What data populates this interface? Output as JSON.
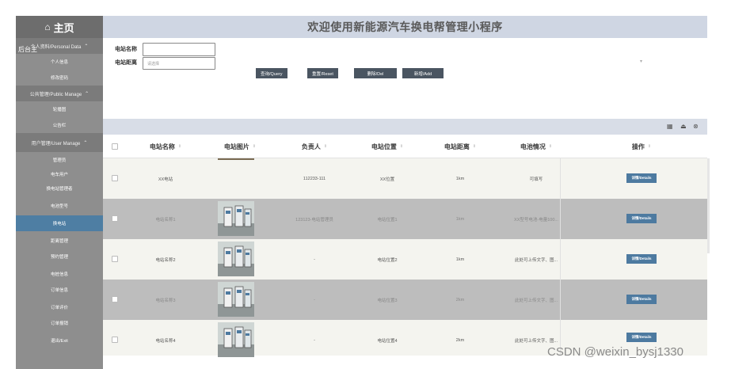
{
  "sidebar": {
    "home": "主页",
    "groups": [
      {
        "label": "个人资料/Personal Data",
        "overlay": "后台主",
        "items": [
          "个人信息",
          "修改密码"
        ]
      },
      {
        "label": "公共管理/Public Manage",
        "items": [
          "轮播图",
          "公告栏"
        ]
      },
      {
        "label": "用户管理/User Manage",
        "items": [
          "管理员",
          "电车用户",
          "换电站管理者",
          "电池型号",
          "换电站",
          "距离管理",
          "预约管理",
          "电桩信息",
          "订单信息",
          "订单评价",
          "订单报销",
          "退出/Exit"
        ]
      }
    ]
  },
  "header": {
    "title": "欢迎使用新能源汽车换电帮管理小程序"
  },
  "search": {
    "station_name_label": "电站名称",
    "distance_label": "电站距离",
    "station_name_value": "",
    "distance_placeholder": "请选择",
    "buttons": [
      "查询/Query",
      "重置/Reset",
      "删除/Del",
      "新增/Add"
    ],
    "dropdown_arrow": "▾"
  },
  "toolbar": {
    "icons": [
      "grid-icon",
      "user-icon",
      "settings-icon"
    ]
  },
  "table": {
    "columns": [
      "电站名称",
      "电站图片",
      "负责人",
      "电站位置",
      "电站距离",
      "电池情况",
      "操作"
    ],
    "rows": [
      {
        "name": "XX电站",
        "manager": "112233-111",
        "location": "XX位置",
        "distance": "1km",
        "battery": "可填写",
        "action": "详情/Details",
        "shade": "#f4f4ef"
      },
      {
        "name": "电站名称1",
        "manager": "123123-电站管理员",
        "location": "电站位置1",
        "distance": "1km",
        "battery": "XX型号电池-电量100...",
        "action": "详情/Details",
        "shade": "#bdbdbd"
      },
      {
        "name": "电站名称2",
        "manager": "-",
        "location": "电站位置2",
        "distance": "1km",
        "battery": "此处可上传文字、图...",
        "action": "详情/Details",
        "shade": "#f4f4ef"
      },
      {
        "name": "电站名称3",
        "manager": "-",
        "location": "电站位置3",
        "distance": "2km",
        "battery": "此处可上传文字、图...",
        "action": "详情/Details",
        "shade": "#bdbdbd"
      },
      {
        "name": "电站名称4",
        "manager": "-",
        "location": "电站位置4",
        "distance": "2km",
        "battery": "此处可上传文字、图...",
        "action": "详情/Details",
        "shade": "#f4f4ef"
      }
    ]
  },
  "watermark": "CSDN @weixin_bysj1330"
}
